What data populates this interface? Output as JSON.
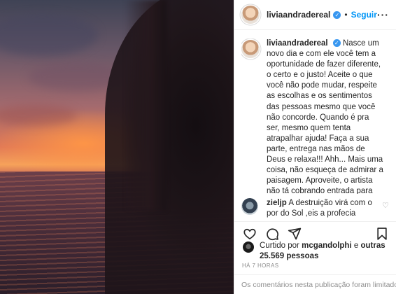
{
  "post": {
    "username": "liviaandradereal",
    "follow_label": "Seguir",
    "separator": "•",
    "more_icon": "more-options-icon",
    "caption": "Nasce um novo dia e com ele você tem a oportunidade de fazer diferente, o certo e o justo! Aceite o que você não pode mudar, respeite as escolhas e os sentimentos das pessoas mesmo que você não concorde. Quando é pra ser, mesmo quem tenta atrapalhar ajuda! Faça a sua parte, entrega nas mãos de Deus e relaxa!!! Ahh... Mais uma coisa, não esqueça de admirar a paisagem. Aproveite, o artista não tá cobrando entrada para esse espetáculo!",
    "caption_time": "7 h"
  },
  "comment": {
    "username": "zieljp",
    "text": "A destruição virá com o por do Sol ,eis a profecia"
  },
  "actions": {
    "like_icon": "heart-icon",
    "comment_icon": "comment-icon",
    "share_icon": "share-icon",
    "save_icon": "bookmark-icon"
  },
  "likes": {
    "prefix": "Curtido por",
    "user": "mcgandolphi",
    "and": "e",
    "others": "outras 25.569 pessoas"
  },
  "posted_ago": "HÁ 7 HORAS",
  "comments_limited": "Os comentários nesta publicação foram limitados.",
  "colors": {
    "link": "#0095f6",
    "verified": "#3897f0",
    "muted": "#8e8e8e"
  }
}
